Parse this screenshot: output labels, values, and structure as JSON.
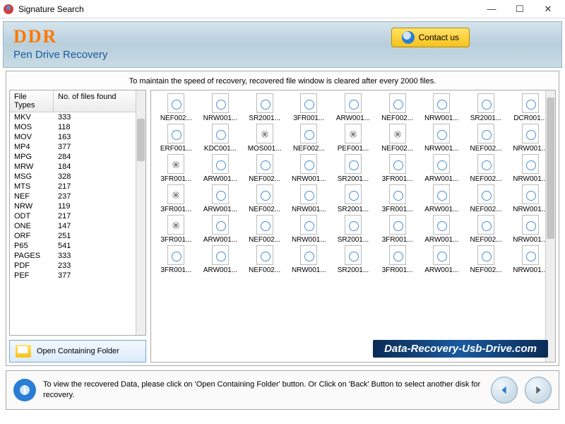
{
  "window": {
    "title": "Signature Search"
  },
  "banner": {
    "logo": "DDR",
    "subtitle": "Pen Drive Recovery",
    "contact": "Contact us"
  },
  "notice": "To maintain the speed of recovery, recovered file window is cleared after every 2000 files.",
  "fileTypes": {
    "header": {
      "c1": "File Types",
      "c2": "No. of files found"
    },
    "rows": [
      {
        "t": "MKV",
        "n": "333"
      },
      {
        "t": "MOS",
        "n": "118"
      },
      {
        "t": "MOV",
        "n": "163"
      },
      {
        "t": "MP4",
        "n": "377"
      },
      {
        "t": "MPG",
        "n": "284"
      },
      {
        "t": "MRW",
        "n": "184"
      },
      {
        "t": "MSG",
        "n": "328"
      },
      {
        "t": "MTS",
        "n": "217"
      },
      {
        "t": "NEF",
        "n": "237"
      },
      {
        "t": "NRW",
        "n": "119"
      },
      {
        "t": "ODT",
        "n": "217"
      },
      {
        "t": "ONE",
        "n": "147"
      },
      {
        "t": "ORF",
        "n": "251"
      },
      {
        "t": "P65",
        "n": "541"
      },
      {
        "t": "PAGES",
        "n": "333"
      },
      {
        "t": "PDF",
        "n": "233"
      },
      {
        "t": "PEF",
        "n": "377"
      }
    ]
  },
  "openFolder": "Open Containing Folder",
  "files": [
    {
      "n": "NEF002...",
      "i": "d"
    },
    {
      "n": "NRW001...",
      "i": "d"
    },
    {
      "n": "SR2001...",
      "i": "d"
    },
    {
      "n": "3FR001...",
      "i": "d"
    },
    {
      "n": "ARW001...",
      "i": "d"
    },
    {
      "n": "NEF002...",
      "i": "d"
    },
    {
      "n": "NRW001...",
      "i": "d"
    },
    {
      "n": "SR2001...",
      "i": "d"
    },
    {
      "n": "DCR001...",
      "i": "d"
    },
    {
      "n": "ERF001...",
      "i": "d"
    },
    {
      "n": "KDC001...",
      "i": "d"
    },
    {
      "n": "MOS001...",
      "i": "a"
    },
    {
      "n": "NEF002...",
      "i": "d"
    },
    {
      "n": "PEF001...",
      "i": "a"
    },
    {
      "n": "NEF002...",
      "i": "a"
    },
    {
      "n": "NRW001...",
      "i": "d"
    },
    {
      "n": "NEF002...",
      "i": "d"
    },
    {
      "n": "NRW001...",
      "i": "d"
    },
    {
      "n": "3FR001...",
      "i": "a"
    },
    {
      "n": "ARW001...",
      "i": "d"
    },
    {
      "n": "NEF002...",
      "i": "d"
    },
    {
      "n": "NRW001...",
      "i": "d"
    },
    {
      "n": "SR2001...",
      "i": "d"
    },
    {
      "n": "3FR001...",
      "i": "d"
    },
    {
      "n": "ARW001...",
      "i": "d"
    },
    {
      "n": "NEF002...",
      "i": "d"
    },
    {
      "n": "NRW001...",
      "i": "d"
    },
    {
      "n": "3FR001...",
      "i": "a"
    },
    {
      "n": "ARW001...",
      "i": "d"
    },
    {
      "n": "NEF002...",
      "i": "d"
    },
    {
      "n": "NRW001...",
      "i": "d"
    },
    {
      "n": "SR2001...",
      "i": "d"
    },
    {
      "n": "3FR001...",
      "i": "d"
    },
    {
      "n": "ARW001...",
      "i": "d"
    },
    {
      "n": "NEF002...",
      "i": "d"
    },
    {
      "n": "NRW001...",
      "i": "d"
    },
    {
      "n": "3FR001...",
      "i": "a"
    },
    {
      "n": "ARW001...",
      "i": "d"
    },
    {
      "n": "NEF002...",
      "i": "d"
    },
    {
      "n": "NRW001...",
      "i": "d"
    },
    {
      "n": "SR2001...",
      "i": "d"
    },
    {
      "n": "3FR001...",
      "i": "d"
    },
    {
      "n": "ARW001...",
      "i": "d"
    },
    {
      "n": "NEF002...",
      "i": "d"
    },
    {
      "n": "NRW001...",
      "i": "d"
    },
    {
      "n": "3FR001...",
      "i": "d"
    },
    {
      "n": "ARW001...",
      "i": "d"
    },
    {
      "n": "NEF002...",
      "i": "d"
    },
    {
      "n": "NRW001...",
      "i": "d"
    },
    {
      "n": "SR2001...",
      "i": "d"
    },
    {
      "n": "3FR001...",
      "i": "d"
    },
    {
      "n": "ARW001...",
      "i": "d"
    },
    {
      "n": "NEF002...",
      "i": "d"
    },
    {
      "n": "NRW001...",
      "i": "d"
    }
  ],
  "brand": "Data-Recovery-Usb-Drive.com",
  "footer": {
    "text": "To view the recovered Data, please click on 'Open Containing Folder' button. Or Click on 'Back' Button to select another disk for recovery."
  }
}
